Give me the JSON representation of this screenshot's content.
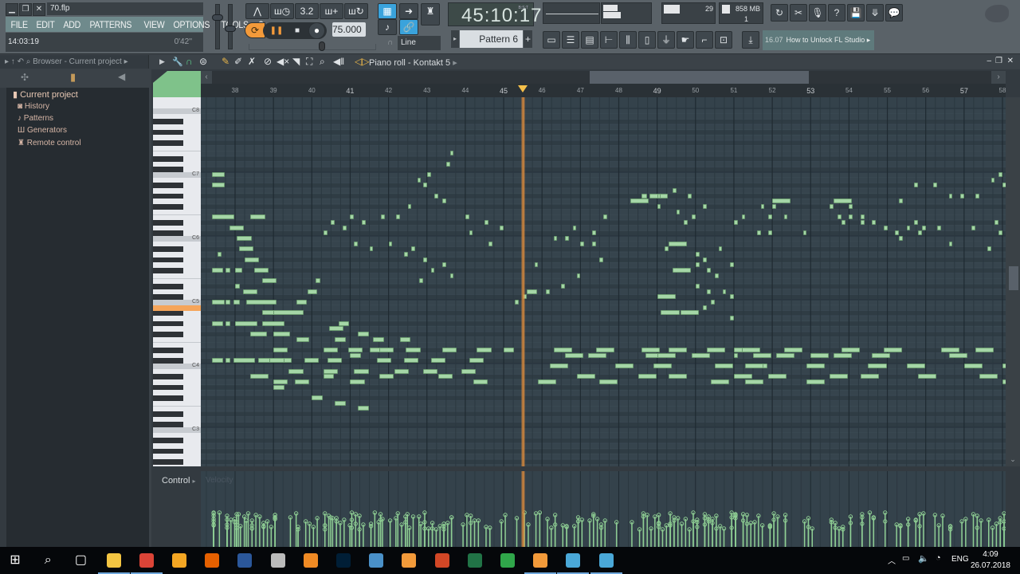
{
  "window": {
    "filename": "70.flp",
    "controls": [
      "minimize",
      "restore",
      "close"
    ]
  },
  "menu": [
    "FILE",
    "EDIT",
    "ADD",
    "PATTERNS",
    "VIEW",
    "OPTIONS",
    "TOOLS",
    "?"
  ],
  "info": {
    "clock": "14:03:19",
    "elapsed": "0'42''"
  },
  "transport": {
    "tempo": "75.000",
    "snap": "Line",
    "song_position": "45:10:17",
    "position_format": "B:S:T",
    "pattern": "Pattern 6"
  },
  "monitor": {
    "cpu": "29",
    "memory": "858 MB",
    "polyphony": "1"
  },
  "hint": {
    "version": "16.07",
    "text": "How to Unlock FL Studio"
  },
  "browser": {
    "title": "Browser - Current project",
    "root": "Current project",
    "items": [
      "History",
      "Patterns",
      "Generators",
      "Remote control"
    ]
  },
  "pianoroll": {
    "title": "Piano roll - Kontakt 5",
    "bars": [
      38,
      39,
      40,
      41,
      42,
      43,
      44,
      45,
      46,
      47,
      48,
      49,
      50,
      51,
      52,
      53,
      54,
      55,
      56,
      57,
      58
    ],
    "key_labels": [
      "C8",
      "C7",
      "C6",
      "C5",
      "C4",
      "C3"
    ],
    "highlighted_key": "B4",
    "playhead_bar": 45.5,
    "control_label": "Control",
    "control_param": "Velocity",
    "note_color": "#a5d6a7",
    "notes": [
      [
        37.55,
        27,
        0.12
      ],
      [
        37.4,
        12,
        0.35
      ],
      [
        37.4,
        14,
        0.35
      ],
      [
        37.4,
        20,
        0.6
      ],
      [
        38.4,
        20,
        0.4
      ],
      [
        37.85,
        22,
        0.4
      ],
      [
        38.05,
        24,
        0.4
      ],
      [
        38.1,
        26,
        0.4
      ],
      [
        38.25,
        28,
        0.4
      ],
      [
        38.5,
        30,
        0.4
      ],
      [
        38.7,
        32,
        0.4
      ],
      [
        37.4,
        30,
        0.3
      ],
      [
        37.75,
        30,
        0.15
      ],
      [
        38.0,
        30,
        0.2
      ],
      [
        38.0,
        33,
        0.15
      ],
      [
        38.2,
        34,
        0.4
      ],
      [
        38.4,
        36,
        0.6
      ],
      [
        38.7,
        38,
        0.5
      ],
      [
        39.0,
        38,
        0.8
      ],
      [
        39.6,
        36,
        0.3
      ],
      [
        39.9,
        34,
        0.25
      ],
      [
        40.1,
        32,
        0.15
      ],
      [
        37.4,
        36,
        0.35
      ],
      [
        37.75,
        36,
        0.15
      ],
      [
        37.95,
        36,
        0.2
      ],
      [
        38.3,
        36,
        0.8
      ],
      [
        37.4,
        40,
        0.3
      ],
      [
        37.75,
        40,
        0.15
      ],
      [
        38.0,
        40,
        0.6
      ],
      [
        38.7,
        40,
        0.6
      ],
      [
        38.4,
        42,
        0.45
      ],
      [
        39.0,
        42,
        0.45
      ],
      [
        39.6,
        43,
        0.35
      ],
      [
        38.8,
        47,
        0.35
      ],
      [
        37.4,
        47,
        0.3
      ],
      [
        37.75,
        47,
        0.15
      ],
      [
        37.95,
        47,
        0.6
      ],
      [
        38.6,
        47,
        0.9
      ],
      [
        38.4,
        50,
        0.5
      ],
      [
        40.7,
        40,
        0.3
      ],
      [
        40.45,
        41,
        0.4
      ],
      [
        41.2,
        42,
        0.3
      ],
      [
        41.5,
        45,
        0.4
      ],
      [
        40.6,
        43,
        0.3
      ],
      [
        41.6,
        43,
        0.3
      ],
      [
        42.3,
        43,
        0.3
      ],
      [
        39.0,
        45,
        0.4
      ],
      [
        40.3,
        45,
        0.4
      ],
      [
        40.95,
        45,
        0.4
      ],
      [
        41.75,
        45,
        0.4
      ],
      [
        42.45,
        45,
        0.4
      ],
      [
        43.4,
        45,
        0.4
      ],
      [
        44.3,
        45,
        0.4
      ],
      [
        45.0,
        45,
        0.3
      ],
      [
        38.9,
        47,
        0.4
      ],
      [
        39.8,
        47,
        0.4
      ],
      [
        40.4,
        47,
        0.4
      ],
      [
        41.0,
        46,
        0.3
      ],
      [
        41.7,
        47,
        0.4
      ],
      [
        42.4,
        47,
        0.4
      ],
      [
        43.1,
        47,
        0.4
      ],
      [
        44.1,
        47,
        0.4
      ],
      [
        39.4,
        49,
        0.4
      ],
      [
        40.3,
        49,
        0.4
      ],
      [
        41.1,
        49,
        0.4
      ],
      [
        42.15,
        49,
        0.4
      ],
      [
        42.9,
        49,
        0.4
      ],
      [
        43.9,
        49,
        0.4
      ],
      [
        39.0,
        51,
        0.4
      ],
      [
        39.55,
        51,
        0.4
      ],
      [
        40.3,
        50,
        0.3
      ],
      [
        41.0,
        51,
        0.4
      ],
      [
        41.75,
        50,
        0.4
      ],
      [
        43.3,
        50,
        0.4
      ],
      [
        44.2,
        51,
        0.4
      ],
      [
        39.0,
        52,
        0.3
      ],
      [
        40.0,
        54,
        0.3
      ],
      [
        40.6,
        55,
        0.3
      ],
      [
        41.2,
        56,
        0.3
      ],
      [
        42.5,
        18,
        0.12
      ],
      [
        42.9,
        14,
        0.12
      ],
      [
        42.75,
        13,
        0.12
      ],
      [
        43.0,
        12,
        0.12
      ],
      [
        43.5,
        10,
        0.12
      ],
      [
        43.6,
        8,
        0.12
      ],
      [
        43.2,
        16,
        0.12
      ],
      [
        43.4,
        17,
        0.12
      ],
      [
        40.5,
        21,
        0.12
      ],
      [
        41.0,
        20,
        0.12
      ],
      [
        41.3,
        21,
        0.12
      ],
      [
        41.8,
        20,
        0.12
      ],
      [
        42.2,
        20,
        0.12
      ],
      [
        40.3,
        23,
        0.12
      ],
      [
        40.8,
        22,
        0.12
      ],
      [
        41.1,
        25,
        0.12
      ],
      [
        41.5,
        26,
        0.12
      ],
      [
        42.0,
        25,
        0.12
      ],
      [
        44.0,
        20,
        0.12
      ],
      [
        44.5,
        21,
        0.12
      ],
      [
        44.9,
        22,
        0.12
      ],
      [
        44.1,
        23,
        0.12
      ],
      [
        44.6,
        25,
        0.12
      ],
      [
        42.4,
        27,
        0.12
      ],
      [
        42.6,
        26,
        0.12
      ],
      [
        42.9,
        28,
        0.12
      ],
      [
        43.1,
        30,
        0.12
      ],
      [
        43.6,
        31,
        0.12
      ],
      [
        43.4,
        29,
        0.12
      ],
      [
        42.8,
        32,
        0.12
      ],
      [
        45.3,
        36,
        0.12
      ],
      [
        45.5,
        35,
        0.12
      ],
      [
        45.6,
        34,
        0.3
      ],
      [
        46.1,
        34,
        0.12
      ],
      [
        45.8,
        29,
        0.12
      ],
      [
        46.5,
        33,
        0.12
      ],
      [
        47.0,
        25,
        0.12
      ],
      [
        47.3,
        23,
        0.12
      ],
      [
        46.8,
        22,
        0.12
      ],
      [
        47.6,
        20,
        0.12
      ],
      [
        46.3,
        24,
        0.12
      ],
      [
        46.6,
        24,
        0.12
      ],
      [
        46.9,
        31,
        0.12
      ],
      [
        47.3,
        25,
        0.12
      ],
      [
        47.5,
        28,
        0.12
      ],
      [
        48.3,
        17,
        0.5
      ],
      [
        48.6,
        16,
        0.15
      ],
      [
        48.8,
        16,
        0.5
      ],
      [
        49.0,
        16,
        0.12
      ],
      [
        49.4,
        15,
        0.12
      ],
      [
        49.8,
        16,
        0.12
      ],
      [
        49.0,
        18,
        0.12
      ],
      [
        49.5,
        19,
        0.12
      ],
      [
        49.9,
        20,
        0.12
      ],
      [
        50.2,
        18,
        0.12
      ],
      [
        49.7,
        21,
        0.12
      ],
      [
        49.3,
        25,
        0.5
      ],
      [
        49.2,
        26,
        0.12
      ],
      [
        50.0,
        27,
        0.12
      ],
      [
        50.2,
        28,
        0.12
      ],
      [
        50.6,
        26,
        0.12
      ],
      [
        49.4,
        30,
        0.5
      ],
      [
        49.0,
        35,
        0.5
      ],
      [
        50.0,
        29,
        0.12
      ],
      [
        50.3,
        30,
        0.12
      ],
      [
        50.5,
        31,
        0.12
      ],
      [
        50.9,
        29,
        0.12
      ],
      [
        50.0,
        33,
        0.12
      ],
      [
        50.3,
        34,
        0.12
      ],
      [
        50.7,
        34,
        0.12
      ],
      [
        50.4,
        36,
        0.12
      ],
      [
        50.9,
        35,
        0.12
      ],
      [
        49.1,
        38,
        0.5
      ],
      [
        49.6,
        38,
        0.5
      ],
      [
        50.2,
        37,
        0.12
      ],
      [
        50.9,
        39,
        0.12
      ],
      [
        46.3,
        45,
        0.5
      ],
      [
        47.4,
        45,
        0.5
      ],
      [
        48.6,
        45,
        0.5
      ],
      [
        49.3,
        45,
        0.5
      ],
      [
        50.3,
        45,
        0.5
      ],
      [
        51.0,
        45,
        0.5
      ],
      [
        46.6,
        46,
        0.5
      ],
      [
        47.2,
        46,
        0.5
      ],
      [
        48.7,
        46,
        0.5
      ],
      [
        49.0,
        46,
        0.5
      ],
      [
        49.9,
        46,
        0.5
      ],
      [
        51.0,
        46,
        0.12
      ],
      [
        46.2,
        48,
        0.5
      ],
      [
        47.9,
        48,
        0.5
      ],
      [
        48.9,
        48,
        0.5
      ],
      [
        50.5,
        48,
        0.5
      ],
      [
        51.4,
        48,
        0.5
      ],
      [
        46.9,
        50,
        0.5
      ],
      [
        48.5,
        50,
        0.5
      ],
      [
        49.3,
        50,
        0.5
      ],
      [
        51.0,
        50,
        0.5
      ],
      [
        45.9,
        51,
        0.5
      ],
      [
        47.5,
        51,
        0.5
      ],
      [
        50.4,
        51,
        0.5
      ],
      [
        52.0,
        17,
        0.5
      ],
      [
        51.7,
        18,
        0.12
      ],
      [
        52.0,
        18,
        0.12
      ],
      [
        51.2,
        20,
        0.12
      ],
      [
        51.9,
        20,
        0.12
      ],
      [
        52.3,
        20,
        0.12
      ],
      [
        51.0,
        21,
        0.12
      ],
      [
        51.9,
        23,
        0.12
      ],
      [
        52.8,
        23,
        0.12
      ],
      [
        51.6,
        23,
        0.12
      ],
      [
        53.6,
        17,
        0.5
      ],
      [
        53.5,
        18,
        0.12
      ],
      [
        54.0,
        18,
        0.12
      ],
      [
        53.7,
        20,
        0.12
      ],
      [
        54.0,
        20,
        0.12
      ],
      [
        54.3,
        20,
        0.12
      ],
      [
        53.8,
        21,
        0.12
      ],
      [
        54.3,
        21,
        0.12
      ],
      [
        54.6,
        21,
        0.12
      ],
      [
        54.9,
        22,
        0.12
      ],
      [
        55.2,
        23,
        0.12
      ],
      [
        55.5,
        22,
        0.12
      ],
      [
        55.9,
        22,
        0.12
      ],
      [
        56.3,
        22,
        0.12
      ],
      [
        55.7,
        21,
        0.12
      ],
      [
        55.8,
        23,
        0.12
      ],
      [
        55.3,
        17,
        0.12
      ],
      [
        55.7,
        14,
        0.12
      ],
      [
        56.2,
        14,
        0.12
      ],
      [
        56.6,
        16,
        0.12
      ],
      [
        56.9,
        16,
        0.12
      ],
      [
        57.3,
        16,
        0.12
      ],
      [
        57.7,
        13,
        0.12
      ],
      [
        57.9,
        12,
        0.12
      ],
      [
        58.2,
        12,
        0.12
      ],
      [
        58.0,
        14,
        0.12
      ],
      [
        58.3,
        15,
        0.12
      ],
      [
        58.2,
        17,
        0.12
      ],
      [
        58.1,
        19,
        0.12
      ],
      [
        57.8,
        21,
        0.12
      ],
      [
        57.9,
        23,
        0.12
      ],
      [
        58.1,
        25,
        0.12
      ],
      [
        58.5,
        27,
        0.12
      ],
      [
        58.4,
        30,
        0.3
      ],
      [
        58.3,
        32,
        0.3
      ],
      [
        55.3,
        24,
        0.12
      ],
      [
        57.6,
        26,
        0.12
      ],
      [
        57.2,
        22,
        0.12
      ],
      [
        56.6,
        25,
        0.12
      ],
      [
        51.2,
        45,
        0.5
      ],
      [
        52.3,
        45,
        0.5
      ],
      [
        53.8,
        45,
        0.5
      ],
      [
        54.9,
        45,
        0.5
      ],
      [
        56.4,
        45,
        0.5
      ],
      [
        57.3,
        45,
        0.5
      ],
      [
        51.5,
        46,
        0.5
      ],
      [
        52.1,
        46,
        0.5
      ],
      [
        53.0,
        46,
        0.5
      ],
      [
        53.6,
        46,
        0.5
      ],
      [
        54.6,
        46,
        0.5
      ],
      [
        56.6,
        46,
        0.5
      ],
      [
        51.3,
        48,
        0.5
      ],
      [
        52.9,
        48,
        0.5
      ],
      [
        54.5,
        48,
        0.5
      ],
      [
        55.5,
        48,
        0.5
      ],
      [
        57.0,
        48,
        0.5
      ],
      [
        58.0,
        48,
        0.5
      ],
      [
        51.9,
        50,
        0.5
      ],
      [
        53.5,
        50,
        0.5
      ],
      [
        54.3,
        50,
        0.5
      ],
      [
        55.8,
        50,
        0.5
      ],
      [
        57.4,
        50,
        0.5
      ],
      [
        51.3,
        51,
        0.5
      ],
      [
        52.9,
        51,
        0.5
      ],
      [
        58.0,
        51,
        0.5
      ],
      [
        58.4,
        51,
        0.5
      ]
    ]
  },
  "taskbar": {
    "apps": [
      "windows-start",
      "search",
      "task-view",
      "file-explorer",
      "chrome",
      "aimp",
      "firefox",
      "word",
      "paint",
      "foxit-reader",
      "photoshop",
      "app-blue",
      "fl-studio",
      "powerpoint",
      "excel",
      "open-office",
      "fl-studio-active",
      "network-monitor",
      "network-monitor-2"
    ],
    "language": "ENG",
    "time": "4:09",
    "date": "26.07.2018"
  }
}
